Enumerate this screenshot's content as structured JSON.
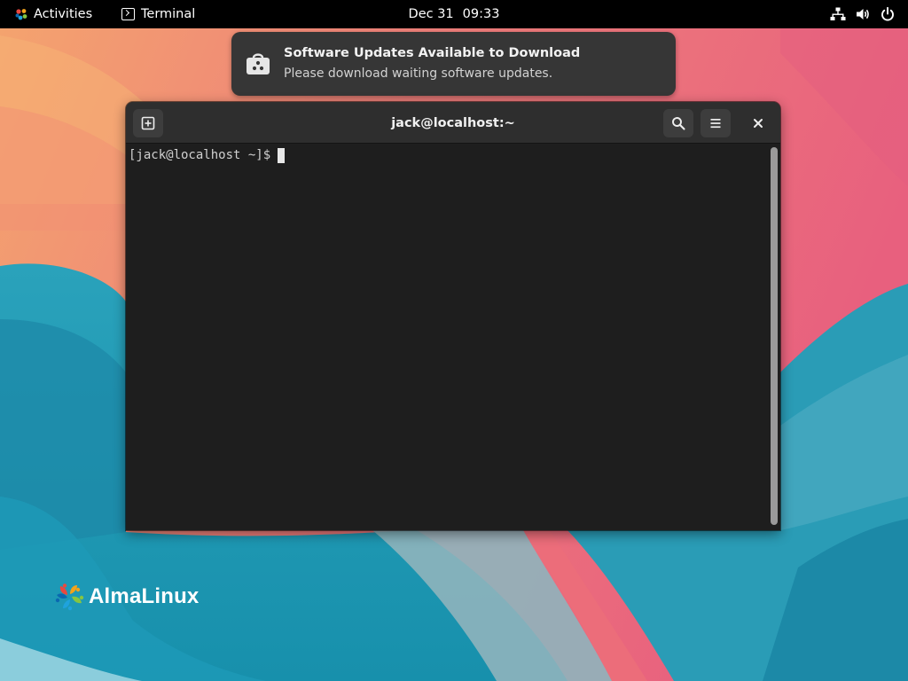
{
  "topbar": {
    "activities_label": "Activities",
    "app_name": "Terminal",
    "clock_date": "Dec 31",
    "clock_time": "09:33",
    "status_icons": [
      "network-wired-icon",
      "volume-icon",
      "power-icon"
    ]
  },
  "notification": {
    "icon": "software-store-icon",
    "title": "Software Updates Available to Download",
    "body": "Please download waiting software updates."
  },
  "terminal": {
    "title": "jack@localhost:~",
    "prompt": "[jack@localhost ~]$",
    "buttons": [
      "new-tab-icon",
      "search-icon",
      "hamburger-menu-icon",
      "close-icon"
    ]
  },
  "desktop": {
    "logo_text": "AlmaLinux"
  },
  "colors": {
    "topbar_bg": "#000000",
    "window_bg": "#1e1e1e",
    "headerbar_bg": "#2e2e2e",
    "notification_bg": "#363636",
    "wallpaper_teal": "#1a8fae",
    "wallpaper_pink": "#ec6d7f",
    "wallpaper_orange": "#f5a36c"
  }
}
